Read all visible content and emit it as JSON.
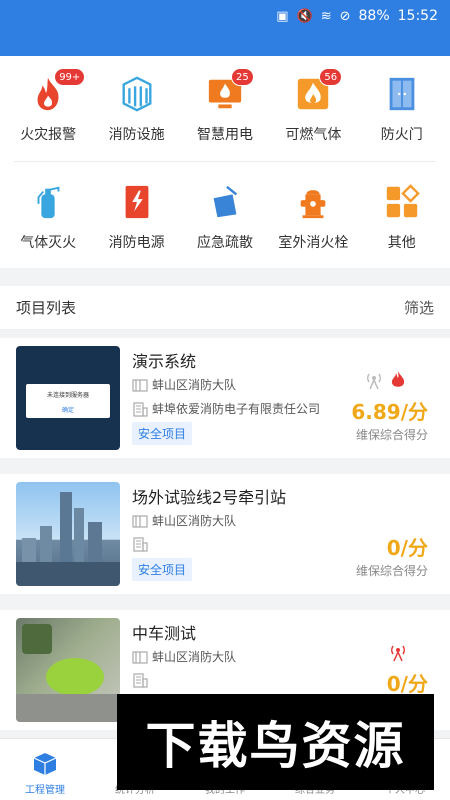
{
  "status_bar": {
    "battery": "88%",
    "time": "15:52"
  },
  "grid": {
    "row1": [
      {
        "label": "火灾报警",
        "icon": "fire-alarm-icon",
        "badge": "99+"
      },
      {
        "label": "消防设施",
        "icon": "fire-facility-icon",
        "badge": ""
      },
      {
        "label": "智慧用电",
        "icon": "smart-electricity-icon",
        "badge": "25"
      },
      {
        "label": "可燃气体",
        "icon": "combustible-gas-icon",
        "badge": "56"
      },
      {
        "label": "防火门",
        "icon": "fire-door-icon",
        "badge": ""
      }
    ],
    "row2": [
      {
        "label": "气体灭火",
        "icon": "gas-extinguisher-icon"
      },
      {
        "label": "消防电源",
        "icon": "fire-power-icon"
      },
      {
        "label": "应急疏散",
        "icon": "emergency-evacuation-icon"
      },
      {
        "label": "室外消火栓",
        "icon": "outdoor-hydrant-icon"
      },
      {
        "label": "其他",
        "icon": "other-grid-icon"
      }
    ]
  },
  "list": {
    "title": "项目列表",
    "filter_label": "筛选",
    "projects": [
      {
        "name": "演示系统",
        "brigade": "蚌山区消防大队",
        "company": "蚌埠依爱消防电子有限责任公司",
        "tag": "安全项目",
        "score": "6.89/分",
        "score_label": "维保综合得分",
        "thumb_text": "未连接到服务器",
        "thumb_button": "确定"
      },
      {
        "name": "场外试验线2号牵引站",
        "brigade": "蚌山区消防大队",
        "company": "",
        "tag": "安全项目",
        "score": "0/分",
        "score_label": "维保综合得分"
      },
      {
        "name": "中车测试",
        "brigade": "蚌山区消防大队",
        "company": "",
        "tag": "",
        "score": "0/分",
        "score_label": ""
      }
    ]
  },
  "tabs": [
    {
      "label": "工程管理",
      "active": true
    },
    {
      "label": "统计分析",
      "active": false
    },
    {
      "label": "我的工作",
      "active": false
    },
    {
      "label": "综合业务",
      "active": false
    },
    {
      "label": "个人中心",
      "active": false
    }
  ],
  "watermark": "下载鸟资源",
  "colors": {
    "primary": "#2f7fe3",
    "orange": "#f0a818",
    "red": "#e53935"
  }
}
